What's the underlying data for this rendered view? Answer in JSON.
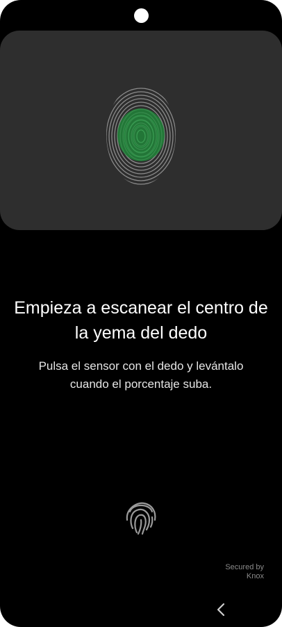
{
  "instructions": {
    "title": "Empieza a escanear el centro de la yema del dedo",
    "subtitle": "Pulsa el sensor con el dedo y levántalo cuando el porcentaje suba."
  },
  "footer": {
    "secured_line1": "Secured by",
    "secured_line2": "Knox"
  },
  "icons": {
    "hero": "fingerprint-center-illustration",
    "sensor": "fingerprint-icon",
    "back": "chevron-left-icon"
  },
  "colors": {
    "background": "#000000",
    "hero_panel": "#2e2e2e",
    "fingerprint_lines": "#8c8c8c",
    "highlight_green": "#1f8a3a"
  }
}
